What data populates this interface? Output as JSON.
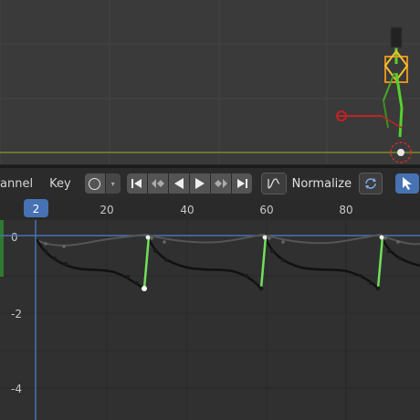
{
  "header": {
    "menu_channel": "annel",
    "menu_key": "Key",
    "normalize_label": "Normalize"
  },
  "playhead": {
    "frame_label": "2"
  },
  "frame_ticks": [
    "20",
    "40",
    "60",
    "80"
  ],
  "value_ticks": [
    "0",
    "-2",
    "-4"
  ],
  "icons": [
    "circle-icon",
    "jump-start-icon",
    "prev-keyframe-icon",
    "play-reverse-icon",
    "play-icon",
    "next-keyframe-icon",
    "jump-end-icon",
    "normalize-curve-icon",
    "sync-icon",
    "select-cursor-icon"
  ],
  "colors": {
    "accent_blue": "#4772b3",
    "selected_curve": "#6fe05a",
    "bone_green": "#55d12e",
    "bone_orange": "#e0901e",
    "bone_red": "#c12222"
  }
}
